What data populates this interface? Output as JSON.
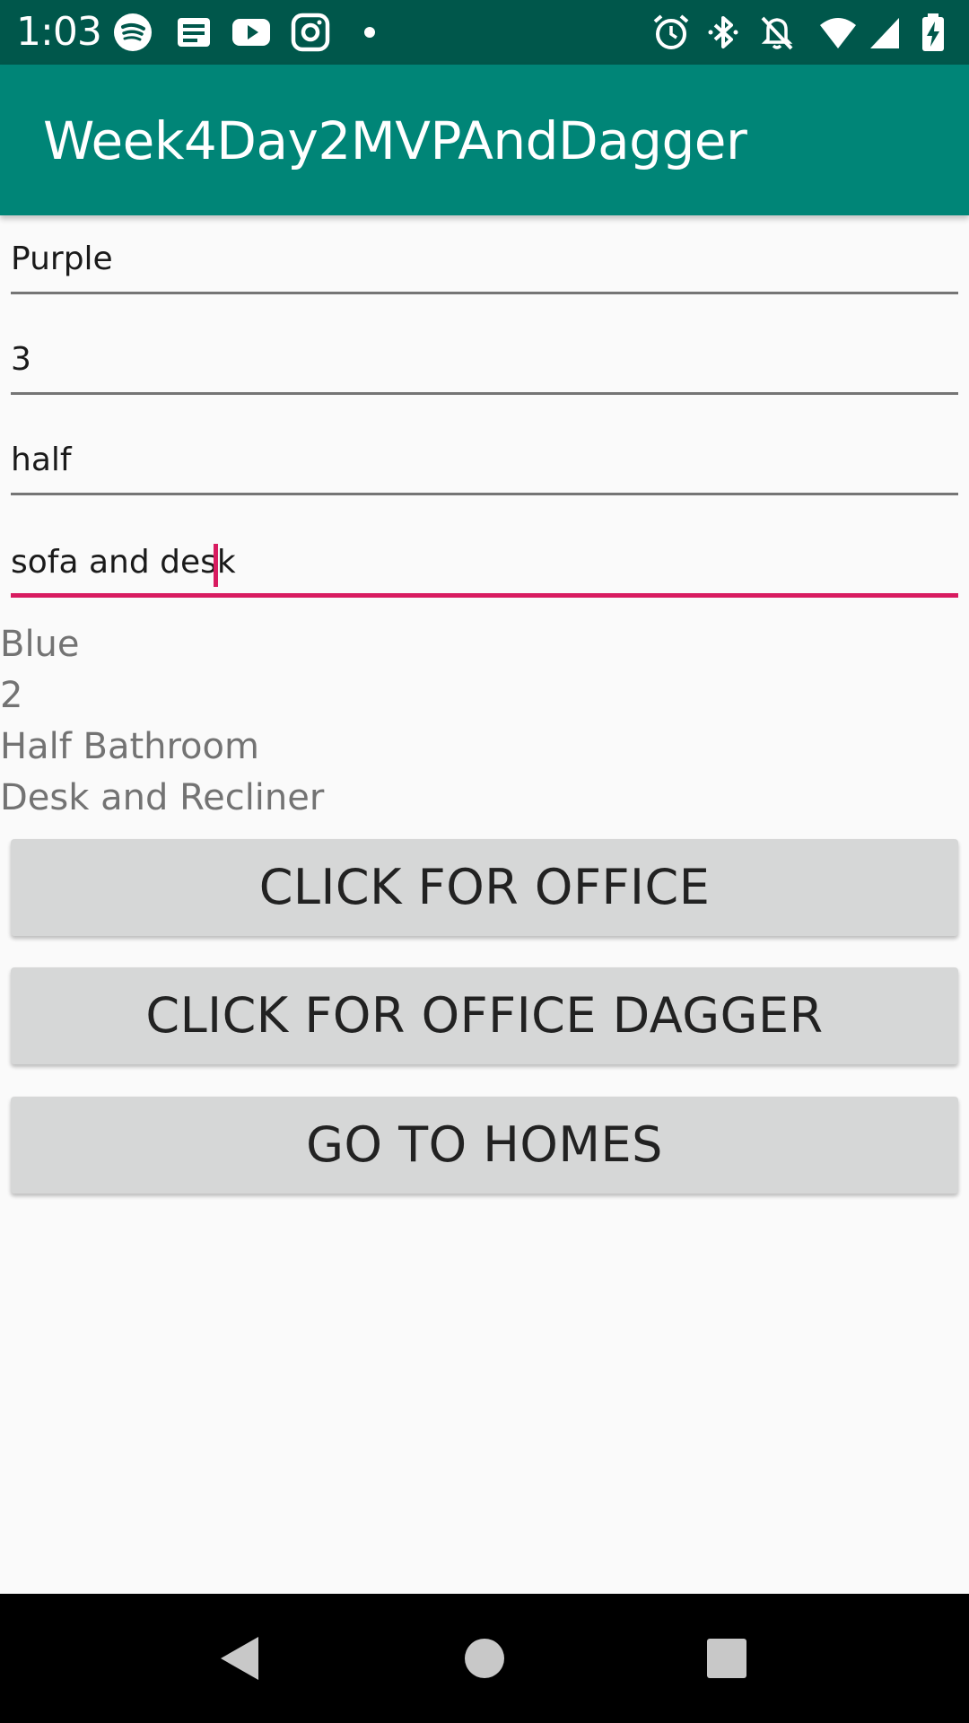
{
  "status_bar": {
    "time": "1:03",
    "left_icons": [
      "spotify-icon",
      "news-icon",
      "youtube-icon",
      "instagram-icon",
      "notification-dot-icon"
    ],
    "right_icons": [
      "alarm-icon",
      "bluetooth-icon",
      "notifications-off-icon",
      "wifi-icon",
      "cell-signal-icon",
      "battery-charging-icon"
    ]
  },
  "app_bar": {
    "title": "Week4Day2MVPAndDagger"
  },
  "form": {
    "color_value": "Purple",
    "rooms_value": "3",
    "bathroom_value": "half",
    "furniture_value": "sofa and desk"
  },
  "results": {
    "color": "Blue",
    "rooms": "2",
    "bathroom": "Half Bathroom",
    "furniture": "Desk and Recliner"
  },
  "buttons": {
    "office": "CLICK FOR OFFICE",
    "office_dagger": "CLICK FOR OFFICE DAGGER",
    "homes": "GO TO HOMES"
  },
  "nav_bar": {
    "icons": [
      "back-icon",
      "home-icon",
      "recents-icon"
    ]
  },
  "colors": {
    "status_bar": "#00574b",
    "app_bar": "#008577",
    "accent": "#d81b60",
    "button": "#d6d7d7"
  }
}
